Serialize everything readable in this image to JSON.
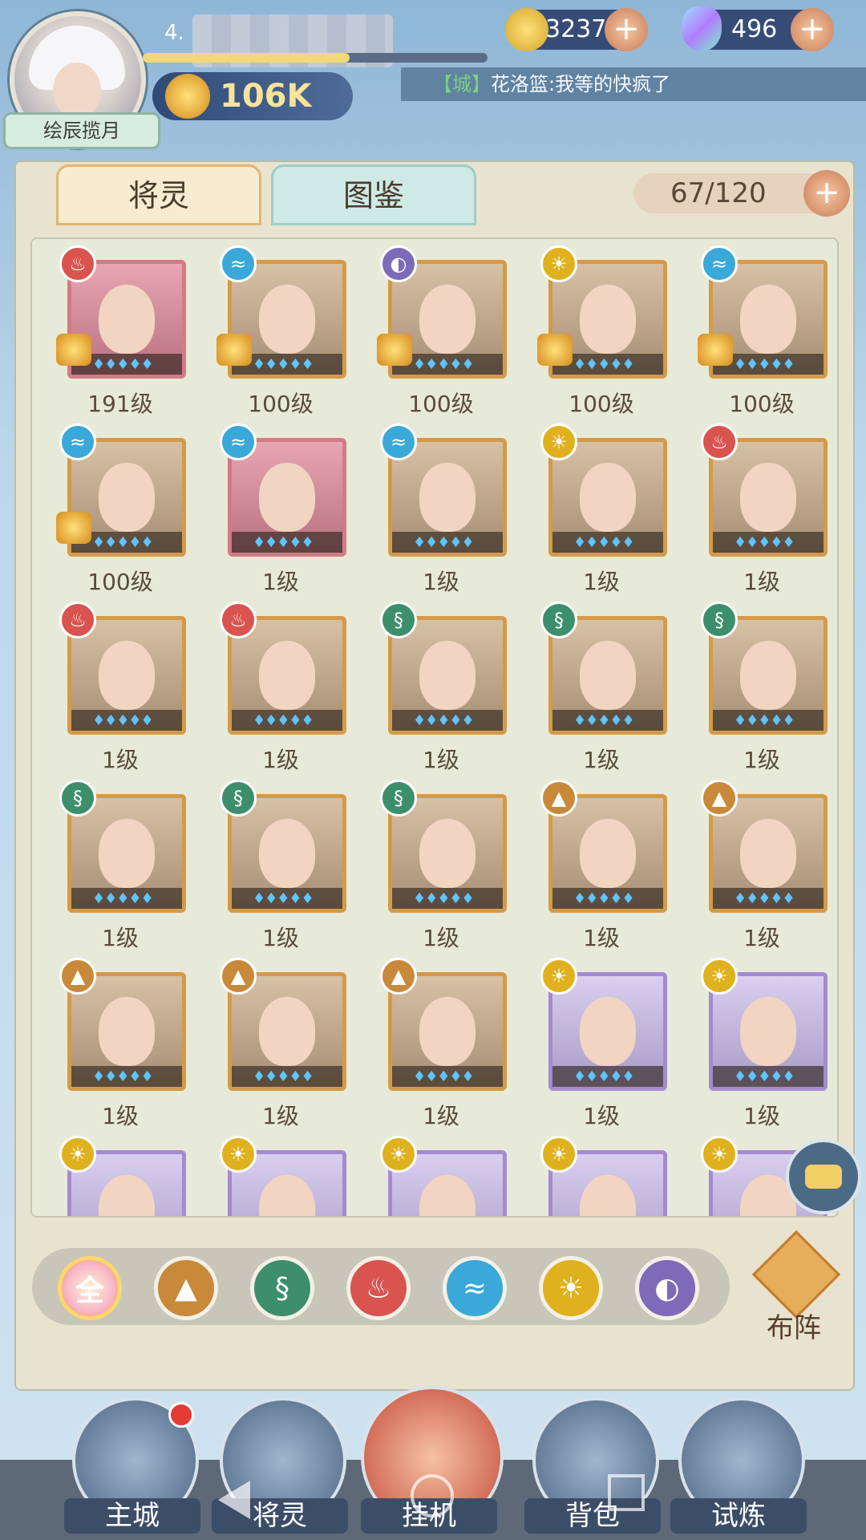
{
  "player": {
    "level_partial": "4.",
    "name": "绘辰揽月",
    "power": "106K",
    "exp_fraction": 0.6
  },
  "resources": {
    "gold": "3237K",
    "gems": "496"
  },
  "chat": {
    "channel": "【城】",
    "message": "花洛篮:我等的快疯了"
  },
  "tabs": [
    {
      "label": "将灵"
    },
    {
      "label": "图鉴"
    }
  ],
  "roster_count": "67/120",
  "icons": {
    "fire": "fire-element-icon",
    "water": "water-element-icon",
    "wind": "wind-element-icon",
    "earth": "earth-element-icon",
    "light": "light-element-icon",
    "dark": "dark-element-icon"
  },
  "heroes": [
    {
      "element": "fire",
      "frame": "pink",
      "level": "191级",
      "crown": true
    },
    {
      "element": "water",
      "frame": "gold",
      "level": "100级",
      "crown": true
    },
    {
      "element": "dark",
      "frame": "gold",
      "level": "100级",
      "crown": true
    },
    {
      "element": "light",
      "frame": "gold",
      "level": "100级",
      "crown": true
    },
    {
      "element": "water",
      "frame": "gold",
      "level": "100级",
      "crown": true
    },
    {
      "element": "water",
      "frame": "gold",
      "level": "100级",
      "crown": true
    },
    {
      "element": "water",
      "frame": "pink",
      "level": "1级",
      "crown": false
    },
    {
      "element": "water",
      "frame": "gold",
      "level": "1级",
      "crown": false
    },
    {
      "element": "light",
      "frame": "gold",
      "level": "1级",
      "crown": false
    },
    {
      "element": "fire",
      "frame": "gold",
      "level": "1级",
      "crown": false
    },
    {
      "element": "fire",
      "frame": "gold",
      "level": "1级",
      "crown": false
    },
    {
      "element": "fire",
      "frame": "gold",
      "level": "1级",
      "crown": false
    },
    {
      "element": "wind",
      "frame": "gold",
      "level": "1级",
      "crown": false
    },
    {
      "element": "wind",
      "frame": "gold",
      "level": "1级",
      "crown": false
    },
    {
      "element": "wind",
      "frame": "gold",
      "level": "1级",
      "crown": false
    },
    {
      "element": "wind",
      "frame": "gold",
      "level": "1级",
      "crown": false
    },
    {
      "element": "wind",
      "frame": "gold",
      "level": "1级",
      "crown": false
    },
    {
      "element": "wind",
      "frame": "gold",
      "level": "1级",
      "crown": false
    },
    {
      "element": "earth",
      "frame": "gold",
      "level": "1级",
      "crown": false
    },
    {
      "element": "earth",
      "frame": "gold",
      "level": "1级",
      "crown": false
    },
    {
      "element": "earth",
      "frame": "gold",
      "level": "1级",
      "crown": false
    },
    {
      "element": "earth",
      "frame": "gold",
      "level": "1级",
      "crown": false
    },
    {
      "element": "earth",
      "frame": "gold",
      "level": "1级",
      "crown": false
    },
    {
      "element": "light",
      "frame": "purple",
      "level": "1级",
      "crown": false
    },
    {
      "element": "light",
      "frame": "purple",
      "level": "1级",
      "crown": false
    },
    {
      "element": "light",
      "frame": "purple",
      "level": "",
      "crown": false
    },
    {
      "element": "light",
      "frame": "purple",
      "level": "",
      "crown": false
    },
    {
      "element": "light",
      "frame": "purple",
      "level": "",
      "crown": false
    },
    {
      "element": "light",
      "frame": "purple",
      "level": "",
      "crown": false
    },
    {
      "element": "light",
      "frame": "purple",
      "level": "",
      "crown": false
    }
  ],
  "filters": [
    {
      "id": "all",
      "label": "全"
    },
    {
      "id": "earth",
      "label": ""
    },
    {
      "id": "wind",
      "label": ""
    },
    {
      "id": "fire",
      "label": ""
    },
    {
      "id": "water",
      "label": ""
    },
    {
      "id": "light",
      "label": ""
    },
    {
      "id": "dark",
      "label": ""
    }
  ],
  "formation_label": "布阵",
  "nav": [
    {
      "label": "主城"
    },
    {
      "label": "将灵"
    },
    {
      "label": "挂机"
    },
    {
      "label": "背包"
    },
    {
      "label": "试炼"
    }
  ]
}
